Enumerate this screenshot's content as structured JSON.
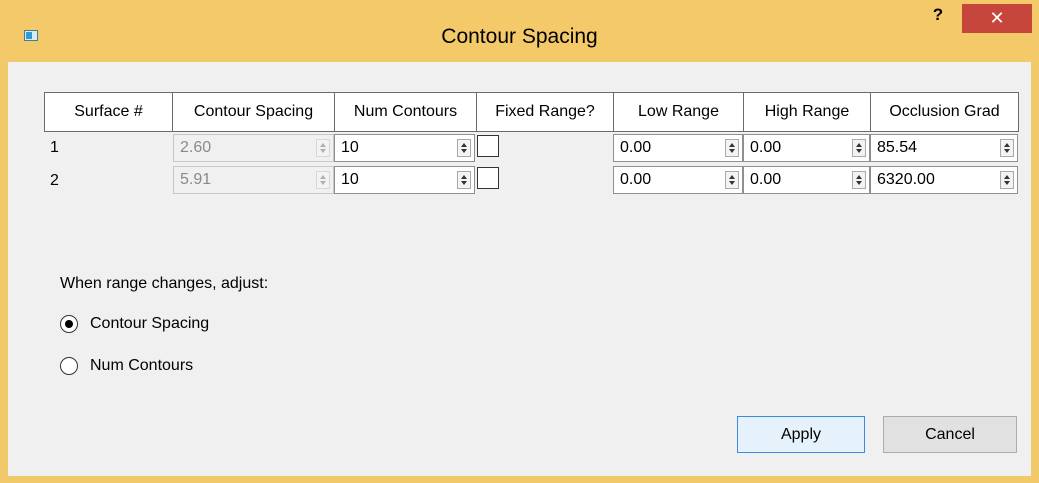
{
  "window": {
    "title": "Contour Spacing",
    "help_label": "?",
    "close_label": "✕"
  },
  "table": {
    "headers": [
      "Surface #",
      "Contour Spacing",
      "Num Contours",
      "Fixed Range?",
      "Low Range",
      "High Range",
      "Occlusion Grad"
    ],
    "rows": [
      {
        "surface": "1",
        "contour_spacing": "2.60",
        "num_contours": "10",
        "fixed_range": false,
        "low_range": "0.00",
        "high_range": "0.00",
        "occlusion_grad": "85.54"
      },
      {
        "surface": "2",
        "contour_spacing": "5.91",
        "num_contours": "10",
        "fixed_range": false,
        "low_range": "0.00",
        "high_range": "0.00",
        "occlusion_grad": "6320.00"
      }
    ]
  },
  "adjust_group": {
    "label": "When range changes, adjust:",
    "options": [
      {
        "label": "Contour Spacing",
        "checked": true
      },
      {
        "label": "Num Contours",
        "checked": false
      }
    ]
  },
  "buttons": {
    "apply": "Apply",
    "cancel": "Cancel"
  },
  "colors": {
    "titlebar": "#f4c96a",
    "close_button": "#c7463c",
    "default_button_border": "#3c8be2"
  }
}
